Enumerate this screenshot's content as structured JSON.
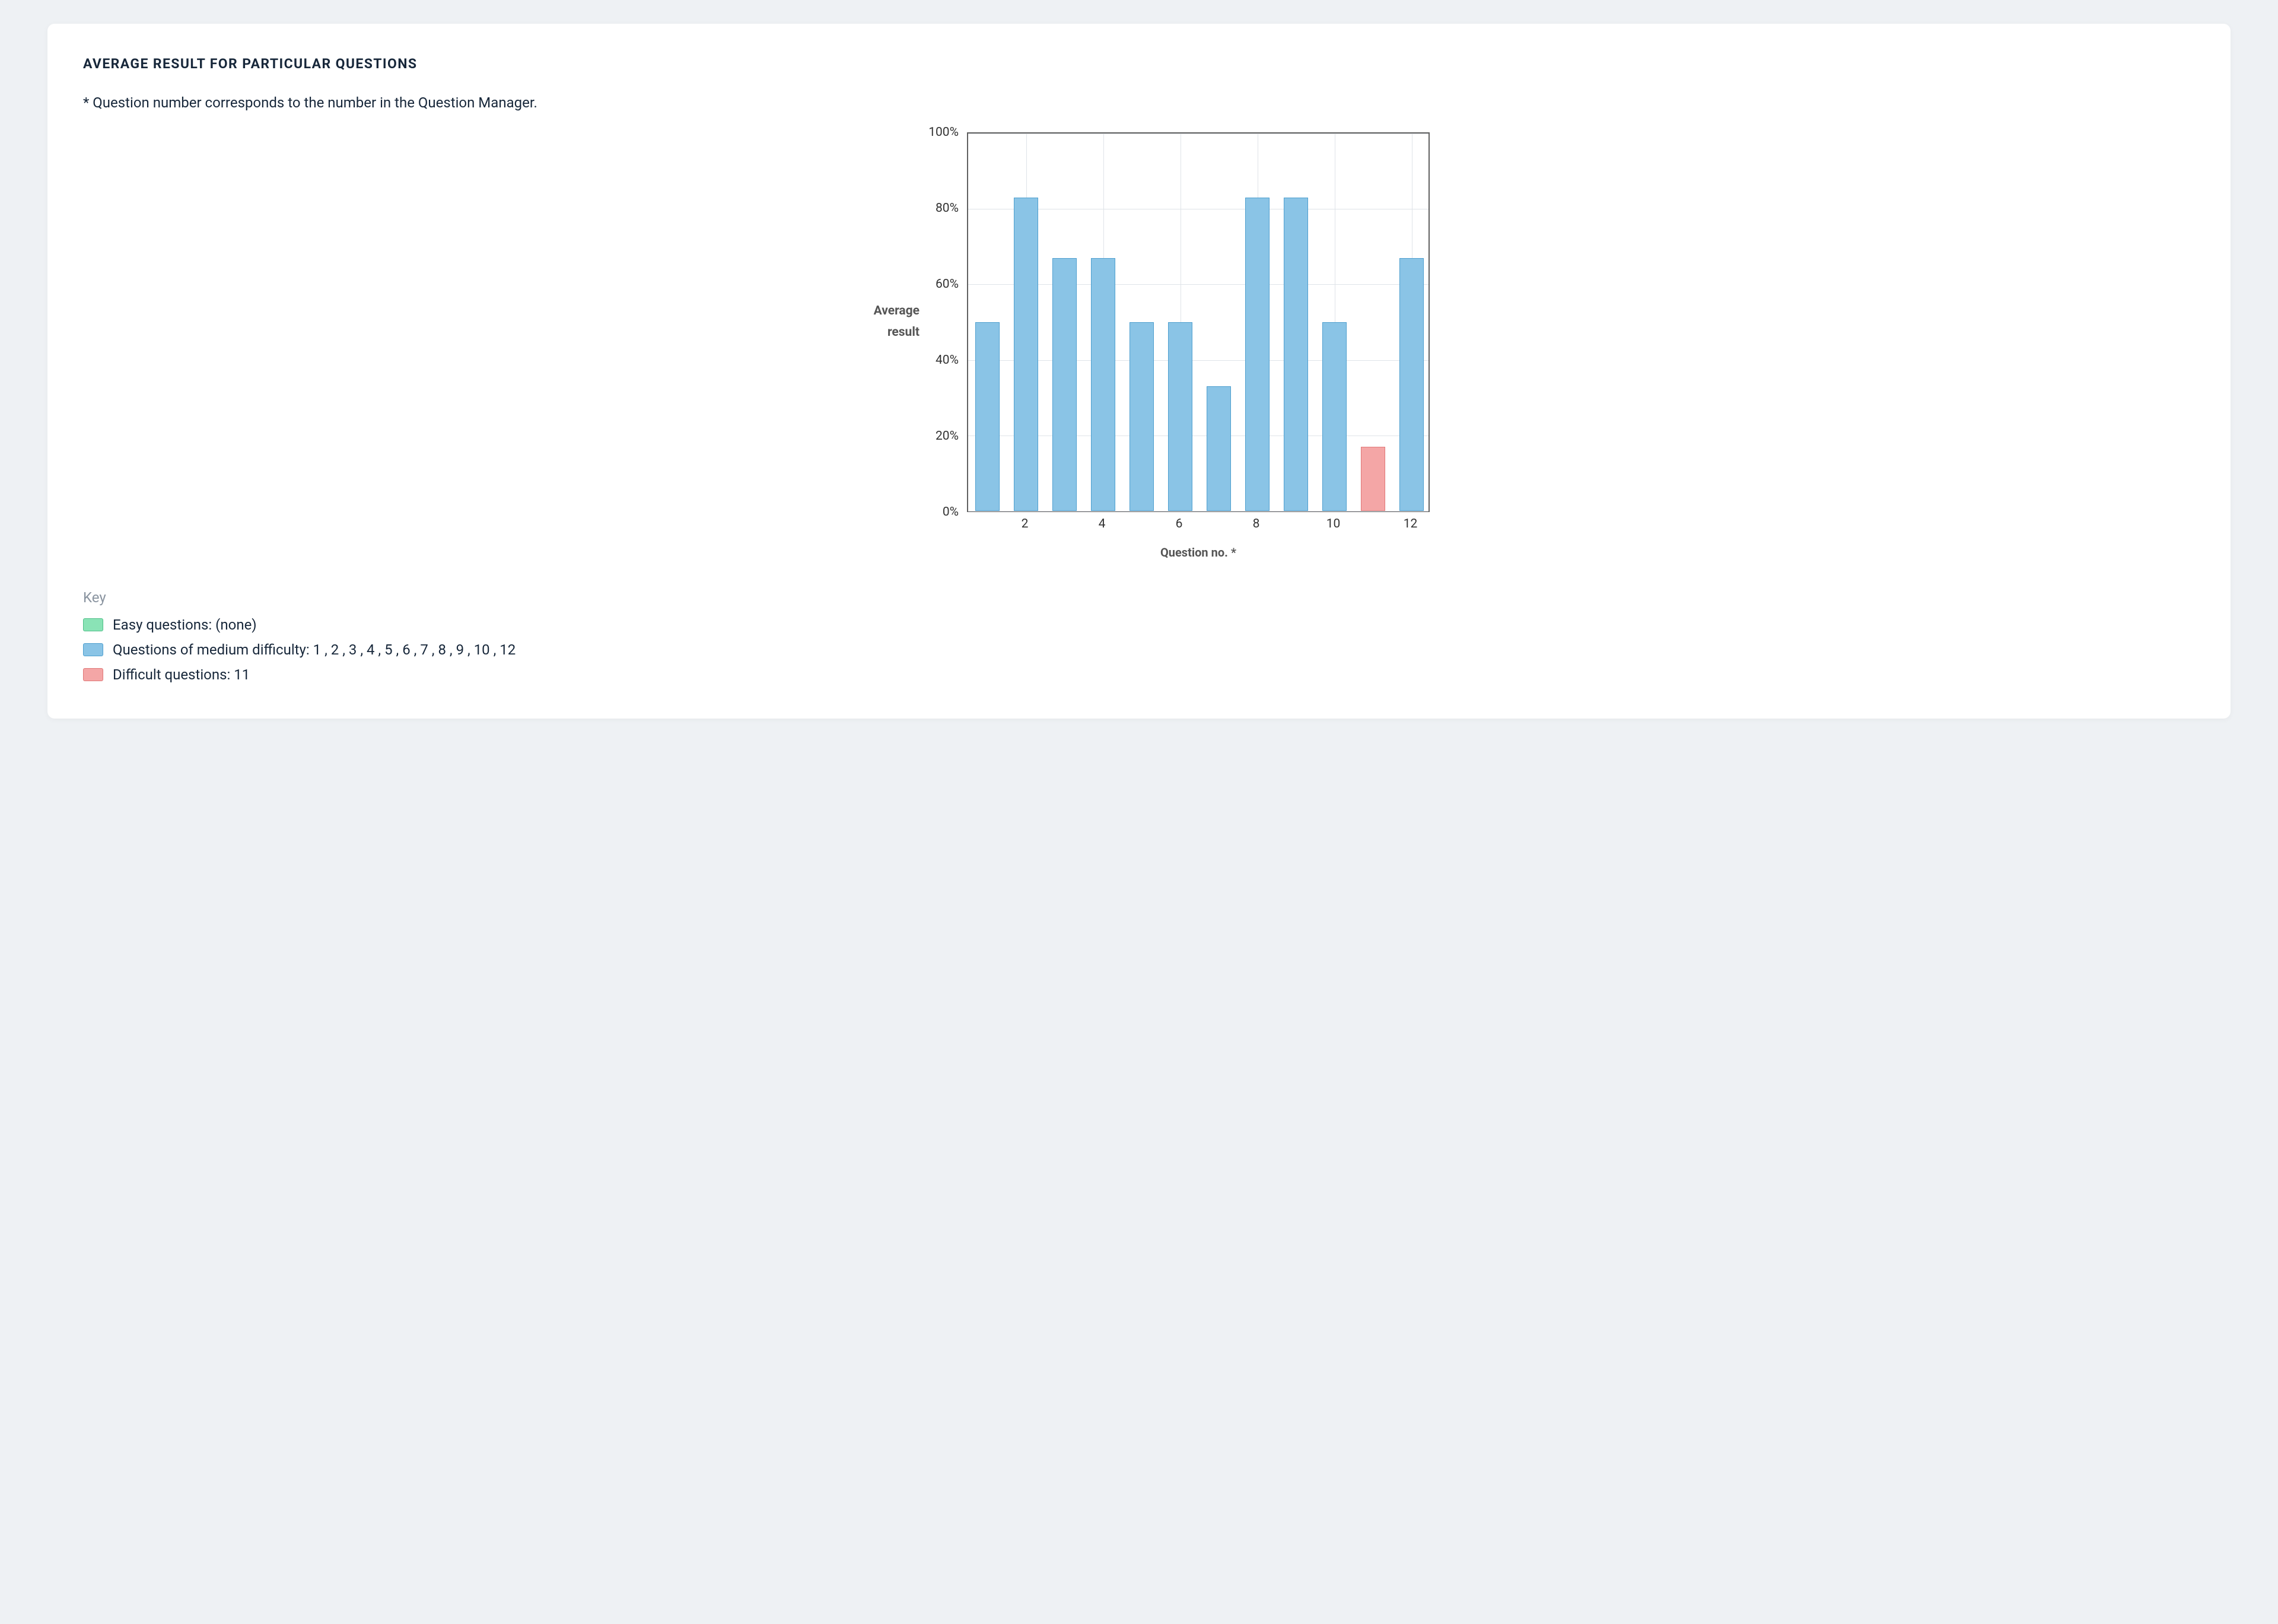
{
  "card": {
    "title": "AVERAGE RESULT FOR PARTICULAR QUESTIONS",
    "note": "* Question number corresponds to the number in the Question Manager."
  },
  "chart_data": {
    "type": "bar",
    "categories": [
      1,
      2,
      3,
      4,
      5,
      6,
      7,
      8,
      9,
      10,
      11,
      12
    ],
    "series": [
      {
        "name": "Average result",
        "values": [
          50,
          83,
          67,
          67,
          50,
          50,
          33,
          83,
          83,
          50,
          17,
          67
        ],
        "difficulty": [
          "medium",
          "medium",
          "medium",
          "medium",
          "medium",
          "medium",
          "medium",
          "medium",
          "medium",
          "medium",
          "difficult",
          "medium"
        ]
      }
    ],
    "xlabel": "Question no. *",
    "ylabel_line1": "Average",
    "ylabel_line2": "result",
    "ylim": [
      0,
      100
    ],
    "yticks": [
      0,
      20,
      40,
      60,
      80,
      100
    ],
    "ytick_labels": [
      "0%",
      "20%",
      "40%",
      "60%",
      "80%",
      "100%"
    ],
    "xticks_shown": [
      2,
      4,
      6,
      8,
      10,
      12
    ]
  },
  "difficulty_colors": {
    "easy": {
      "fill": "#8ae3b6",
      "stroke": "#4fbf88"
    },
    "medium": {
      "fill": "#8ac4e6",
      "stroke": "#4e9fcf"
    },
    "difficult": {
      "fill": "#f4a6a6",
      "stroke": "#e07878"
    }
  },
  "legend": {
    "title": "Key",
    "items": [
      {
        "key": "easy",
        "label": "Easy questions: (none)"
      },
      {
        "key": "medium",
        "label": "Questions of medium difficulty: 1 , 2 , 3 , 4 , 5 , 6 , 7 , 8 , 9 , 10 , 12"
      },
      {
        "key": "difficult",
        "label": "Difficult questions: 11"
      }
    ]
  }
}
